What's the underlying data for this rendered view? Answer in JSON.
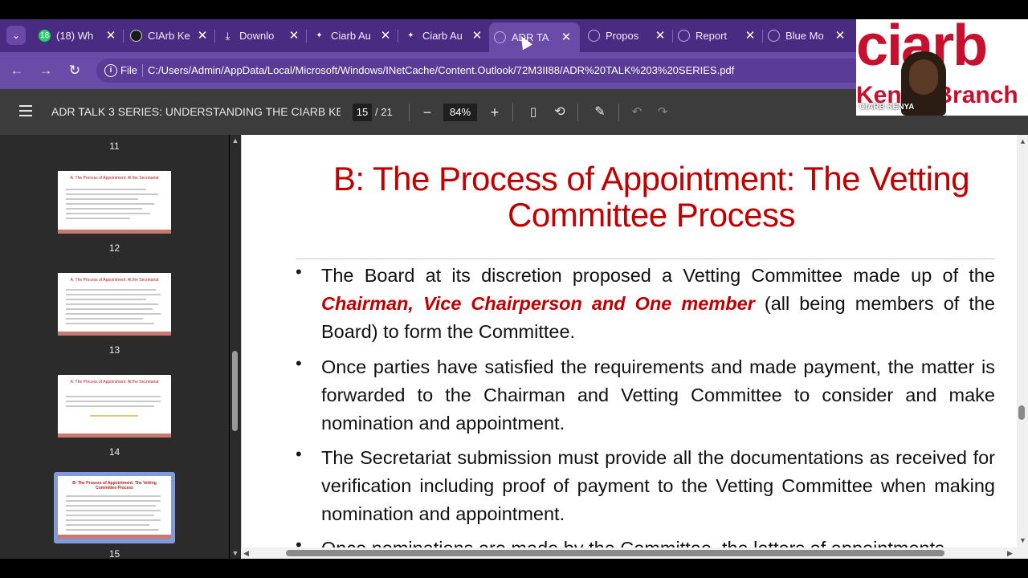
{
  "browser": {
    "tabs": [
      {
        "title": "(18) Wh",
        "badge": "18",
        "icon": "whatsapp-icon",
        "active": false
      },
      {
        "title": "CIArb Ke",
        "icon": "ciarb-icon",
        "active": false
      },
      {
        "title": "Downlo",
        "icon": "download-icon",
        "active": false
      },
      {
        "title": "Ciarb Au",
        "icon": "ciarb-icon",
        "active": false
      },
      {
        "title": "Ciarb Au",
        "icon": "ciarb-icon",
        "active": false
      },
      {
        "title": "ADR TA",
        "icon": "globe-icon",
        "active": true
      },
      {
        "title": "Propos",
        "icon": "globe-icon",
        "active": false
      },
      {
        "title": "Report",
        "icon": "globe-icon",
        "active": false
      },
      {
        "title": "Blue Mo",
        "icon": "globe-icon",
        "active": false
      }
    ],
    "omnibox": {
      "scheme_label": "File",
      "url": "C:/Users/Admin/AppData/Local/Microsoft/Windows/INetCache/Content.Outlook/72M3II88/ADR%20TALK%203%20SERIES.pdf"
    }
  },
  "pdf_toolbar": {
    "title": "ADR TALK 3 SERIES: UNDERSTANDING THE CIARB KE...",
    "current_page": "15",
    "total_pages": "/ 21",
    "zoom": "84%"
  },
  "webcam": {
    "logo": "ciarb",
    "sub": "Kenya Branch",
    "label": "CIARB KENYA"
  },
  "thumbnails": [
    {
      "num": "11"
    },
    {
      "num": "12",
      "title": "A: The Process of Appointment: At the Secretariat"
    },
    {
      "num": "13",
      "title": "A: The Process of Appointment: At the Secretariat"
    },
    {
      "num": "14",
      "title": "A: The Process of Appointment: At the Secretariat"
    },
    {
      "num": "15",
      "title": "B: The Process of Appointment: The Vetting Committee Process"
    }
  ],
  "slide": {
    "title": "B: The Process of Appointment: The Vetting Committee Process",
    "bullets": [
      {
        "pre": "The Board at its discretion proposed a Vetting Committee made up of the ",
        "emph": "Chairman, Vice Chairperson and One member",
        "post": " (all being members of the Board) to form the Committee."
      },
      {
        "pre": "Once parties have satisfied the requirements and made payment, the matter is forwarded to the Chairman and Vetting Committee to consider and make nomination and appointment."
      },
      {
        "pre": "The Secretariat submission must provide all the documentations as received for verification including proof of payment to the Vetting Committee when making nomination and appointment."
      },
      {
        "pre": "Once nominations are made by the Committee, the letters of appointments"
      }
    ]
  }
}
